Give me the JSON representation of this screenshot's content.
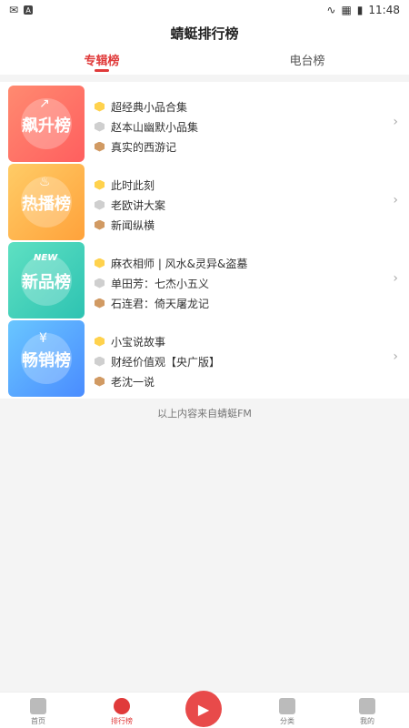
{
  "status_bar": {
    "time": "11:48"
  },
  "header": {
    "title": "蜻蜓排行榜"
  },
  "tabs": [
    {
      "label": "专辑榜",
      "active": true
    },
    {
      "label": "电台榜",
      "active": false
    }
  ],
  "rankings": [
    {
      "card_label": "飙升榜",
      "card_gradient": [
        "#ff8a70",
        "#ff5f5f"
      ],
      "badge_icon": "trend-up-icon",
      "items": [
        {
          "title": "超经典小品合集",
          "rank_color": "#ffd24d"
        },
        {
          "title": "赵本山幽默小品集",
          "rank_color": "#cfcfcf"
        },
        {
          "title": "真实的西游记",
          "rank_color": "#d19a63"
        }
      ]
    },
    {
      "card_label": "热播榜",
      "card_gradient": [
        "#ffcc66",
        "#ffa23b"
      ],
      "badge_icon": "flame-icon",
      "items": [
        {
          "title": "此时此刻",
          "rank_color": "#ffd24d"
        },
        {
          "title": "老欧讲大案",
          "rank_color": "#cfcfcf"
        },
        {
          "title": "新闻纵横",
          "rank_color": "#d19a63"
        }
      ]
    },
    {
      "card_label": "新品榜",
      "card_gradient": [
        "#5ee0c2",
        "#2ec3b2"
      ],
      "badge_icon": "new-badge-icon",
      "badge_text": "NEW",
      "items": [
        {
          "title": "麻衣相师 | 风水&灵异&盗墓",
          "rank_color": "#ffd24d"
        },
        {
          "title": "单田芳：七杰小五义",
          "rank_color": "#cfcfcf"
        },
        {
          "title": "石连君：倚天屠龙记",
          "rank_color": "#d19a63"
        }
      ]
    },
    {
      "card_label": "畅销榜",
      "card_gradient": [
        "#69c6ff",
        "#4a8cff"
      ],
      "badge_icon": "yen-coin-icon",
      "badge_text": "¥",
      "items": [
        {
          "title": "小宝说故事",
          "rank_color": "#ffd24d"
        },
        {
          "title": "财经价值观【央广版】",
          "rank_color": "#cfcfcf"
        },
        {
          "title": "老沈一说",
          "rank_color": "#d19a63"
        }
      ]
    }
  ],
  "footer_note": "以上内容来自蜻蜓FM",
  "bottom_nav": {
    "home": "首页",
    "rank": "排行榜",
    "category": "分类",
    "mine": "我的"
  }
}
